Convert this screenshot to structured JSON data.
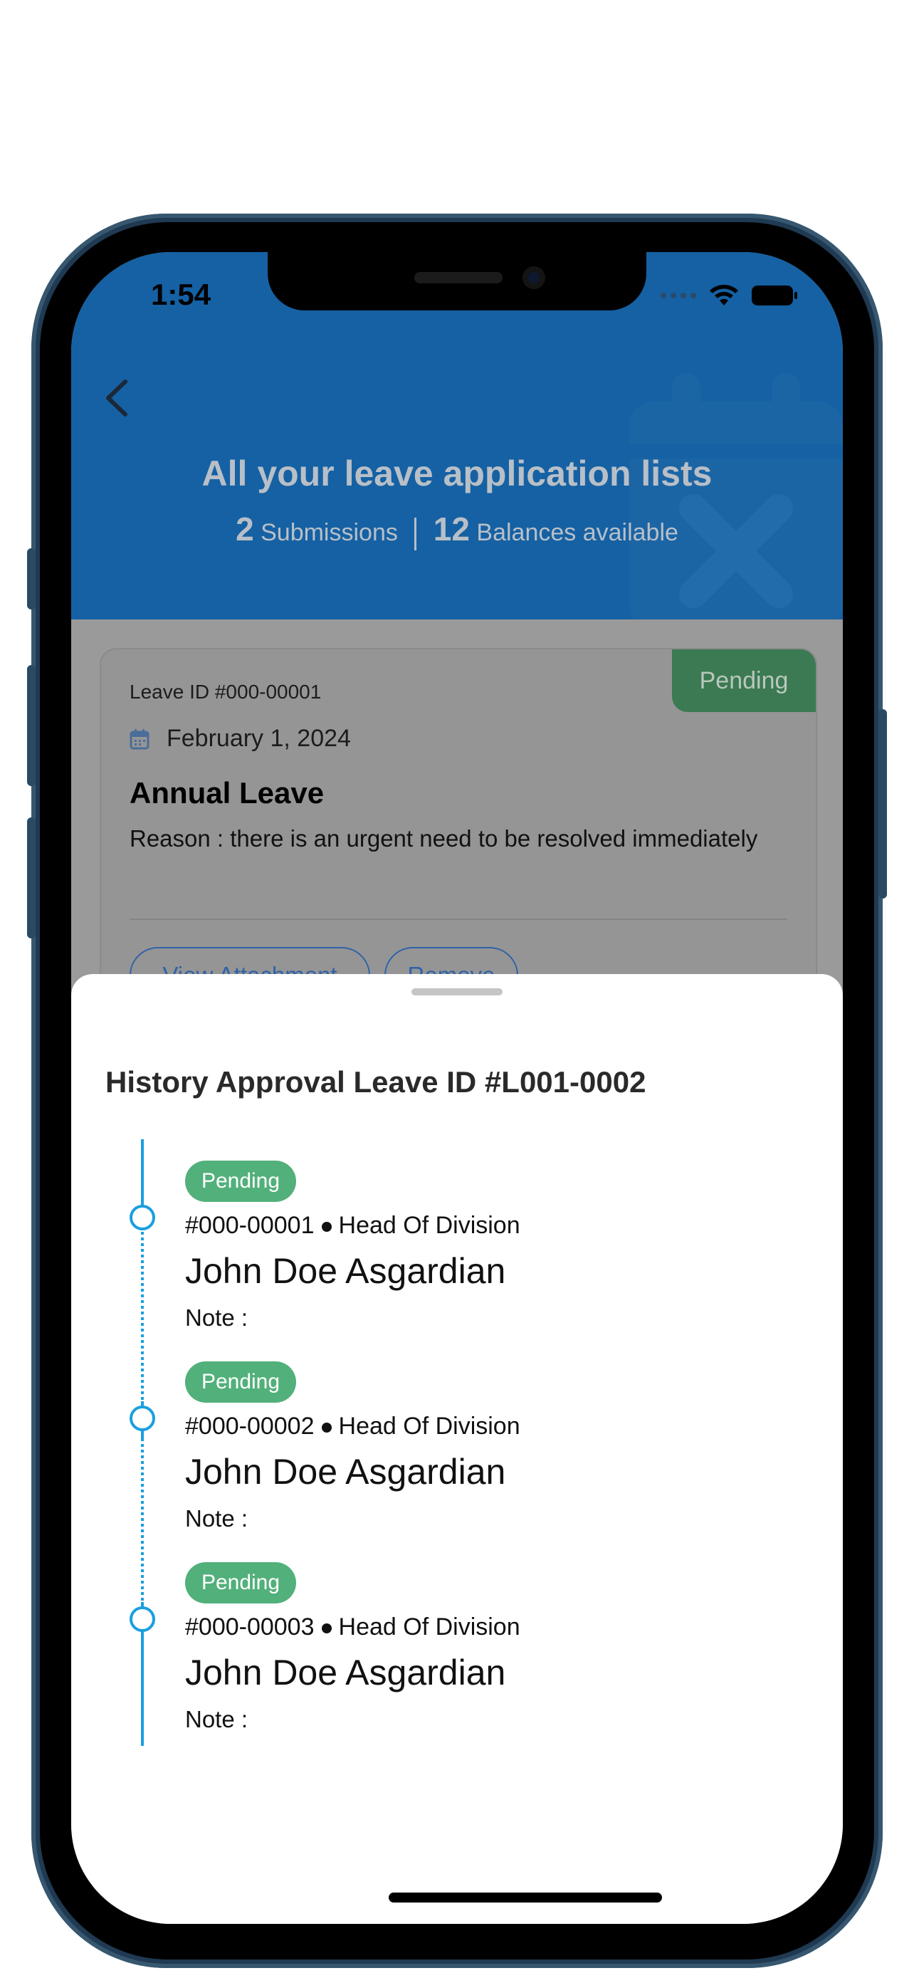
{
  "status_bar": {
    "time": "1:54"
  },
  "header": {
    "title": "All your leave application lists",
    "submissions_count": "2",
    "submissions_label": "Submissions",
    "balances_count": "12",
    "balances_label": "Balances available"
  },
  "card": {
    "status": "Pending",
    "leave_id": "Leave ID #000-00001",
    "date": "February 1, 2024",
    "type": "Annual Leave",
    "reason": "Reason : there is an urgent need to be resolved immediately",
    "view_attachment": "View Attachment",
    "remove": "Remove"
  },
  "sheet": {
    "title": "History Approval Leave ID #L001-0002",
    "items": [
      {
        "status": "Pending",
        "id": "#000-00001",
        "role": "Head Of Division",
        "name": "John Doe Asgardian",
        "note": "Note :"
      },
      {
        "status": "Pending",
        "id": "#000-00002",
        "role": "Head Of Division",
        "name": "John Doe Asgardian",
        "note": "Note :"
      },
      {
        "status": "Pending",
        "id": "#000-00003",
        "role": "Head Of Division",
        "name": "John Doe Asgardian",
        "note": "Note :"
      }
    ]
  },
  "colors": {
    "header_bg": "#1561a4",
    "pending_green": "#52b07a",
    "timeline_blue": "#1a9fe0",
    "button_blue": "#2f62a8"
  },
  "icons": [
    "back-chevron-icon",
    "calendar-icon",
    "wifi-icon",
    "battery-icon",
    "calendar-x-icon"
  ]
}
